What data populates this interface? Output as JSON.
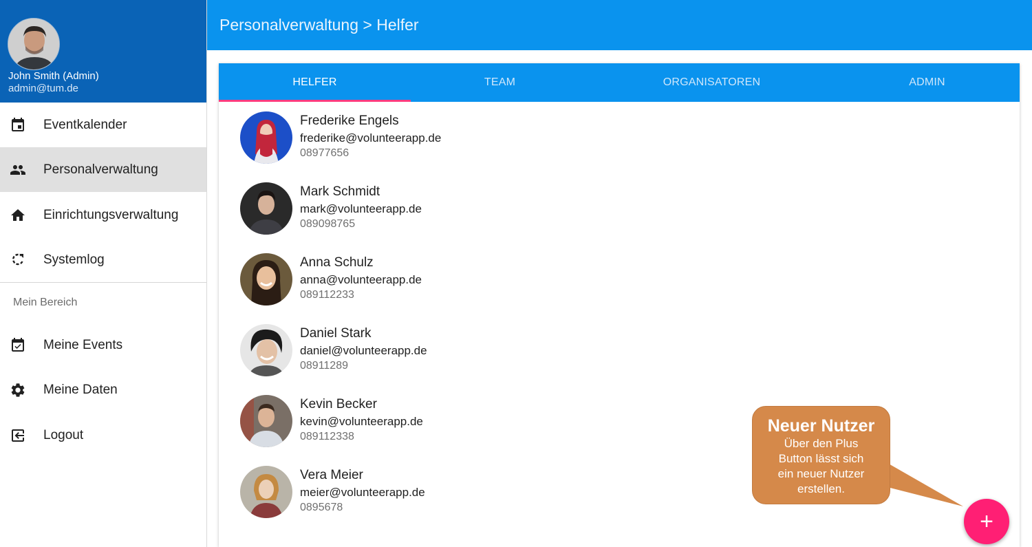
{
  "user": {
    "name": "John Smith (Admin)",
    "email": "admin@tum.de"
  },
  "nav": {
    "items": [
      {
        "label": "Eventkalender",
        "icon": "calendar-event-icon"
      },
      {
        "label": "Personalverwaltung",
        "icon": "people-icon",
        "active": true
      },
      {
        "label": "Einrichtungsverwaltung",
        "icon": "home-icon"
      },
      {
        "label": "Systemlog",
        "icon": "refresh-icon"
      }
    ],
    "section_header": "Mein Bereich",
    "my_items": [
      {
        "label": "Meine Events",
        "icon": "calendar-check-icon"
      },
      {
        "label": "Meine Daten",
        "icon": "gear-icon"
      },
      {
        "label": "Logout",
        "icon": "logout-icon"
      }
    ]
  },
  "header": {
    "title": "Personalverwaltung > Helfer"
  },
  "tabs": [
    {
      "label": "HELFER",
      "active": true
    },
    {
      "label": "TEAM"
    },
    {
      "label": "ORGANISATOREN"
    },
    {
      "label": "ADMIN"
    }
  ],
  "people": [
    {
      "name": "Frederike Engels",
      "email": "frederike@volunteerapp.de",
      "phone": "08977656"
    },
    {
      "name": "Mark Schmidt",
      "email": "mark@volunteerapp.de",
      "phone": "089098765"
    },
    {
      "name": "Anna Schulz",
      "email": "anna@volunteerapp.de",
      "phone": "089112233"
    },
    {
      "name": "Daniel Stark",
      "email": "daniel@volunteerapp.de",
      "phone": "08911289"
    },
    {
      "name": "Kevin Becker",
      "email": "kevin@volunteerapp.de",
      "phone": "089112338"
    },
    {
      "name": "Vera Meier",
      "email": "meier@volunteerapp.de",
      "phone": "0895678"
    }
  ],
  "callout": {
    "title": "Neuer Nutzer",
    "lines": [
      "Über den Plus",
      "Button lässt sich",
      "ein neuer Nutzer",
      "erstellen."
    ]
  },
  "fab": {
    "label": "+"
  },
  "colors": {
    "profile_bg": "#0a63b6",
    "primary": "#0a93ee",
    "accent": "#ff1f74",
    "tab_indicator": "#ff3d7f",
    "callout": "#d5894a"
  }
}
